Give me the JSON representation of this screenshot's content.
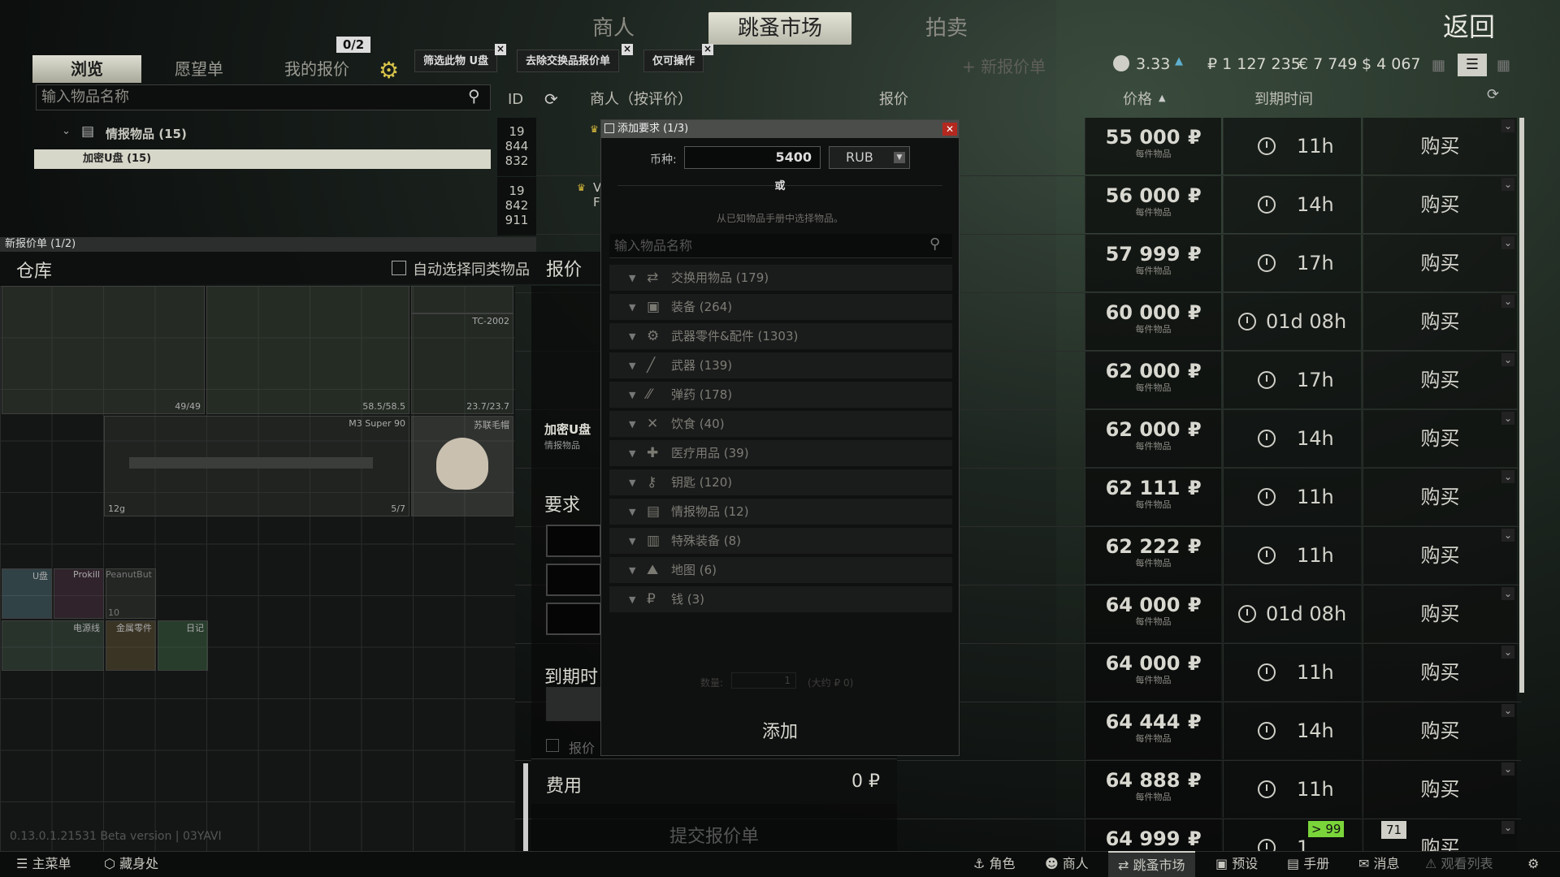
{
  "nav": {
    "tabs": [
      "商人",
      "跳蚤市场",
      "拍卖"
    ],
    "active": "跳蚤市场",
    "back": "返回"
  },
  "subtabs": {
    "browse": "浏览",
    "wishlist": "愿望单",
    "my_offers": "我的报价",
    "offer_count": "0/2"
  },
  "filters": {
    "chips": [
      "筛选此物 U盘",
      "去除交换品报价单",
      "仅可操作"
    ],
    "new_offer": "+ 新报价单"
  },
  "currency": {
    "rep": "3.33",
    "rub": "₽ 1 127 235",
    "eur": "€ 7 749",
    "usd": "$ 4 067"
  },
  "search": {
    "placeholder": "输入物品名称"
  },
  "tree": {
    "category": "情报物品 (15)",
    "item": "加密U盘 (15)"
  },
  "columns": {
    "id": "ID",
    "trader": "商人（按评价）",
    "offer": "报价",
    "price": "价格",
    "expiry": "到期时间"
  },
  "offers_top": [
    {
      "id": "19\n844\n832"
    },
    {
      "id": "19\n842\n911",
      "trader_letter": "V\nF"
    }
  ],
  "rows": [
    {
      "price": "55 000",
      "time": "11h"
    },
    {
      "price": "56 000",
      "time": "14h"
    },
    {
      "price": "57 999",
      "time": "17h"
    },
    {
      "price": "60 000",
      "time": "01d 08h"
    },
    {
      "price": "62 000",
      "time": "17h"
    },
    {
      "price": "62 000",
      "time": "14h"
    },
    {
      "price": "62 111",
      "time": "11h"
    },
    {
      "price": "62 222",
      "time": "11h"
    },
    {
      "price": "64 000",
      "time": "01d 08h"
    },
    {
      "price": "64 000",
      "time": "11h"
    },
    {
      "price": "64 444",
      "time": "14h"
    },
    {
      "price": "64 888",
      "time": "11h"
    },
    {
      "price": "64 999",
      "time": "1"
    }
  ],
  "row_labels": {
    "per_item": "每件物品",
    "buy": "购买",
    "currency_symbol": "₽"
  },
  "last_row": {
    "badge": "> 99",
    "seller_badge": "71"
  },
  "new_offer_panel": {
    "title": "新报价单 (1/2)",
    "stash": "仓库",
    "auto_select": "自动选择同类物品",
    "offer_label": "报价",
    "item_name": "加密U盘",
    "item_cat": "情报物品",
    "requirements": "要求",
    "expiry": "到期时",
    "cost_label": "费用",
    "cost_value": "0 ₽",
    "submit": "提交报价单",
    "offer_checkbox": "报价"
  },
  "stash_items": {
    "armor_count": "49/49",
    "rig_dur": "58.5/58.5",
    "helmet_dur": "23.7/23.7",
    "helmet_tag": "TC-2002",
    "shotgun": "M3 Super 90",
    "shotgun_weight": "12g",
    "shotgun_count": "5/7",
    "hat": "苏联毛帽",
    "usb": "U盘",
    "prokill": "Prokill",
    "peanut": "PeanutBut",
    "peanut_cnt": "10",
    "cable": "电源线",
    "parts": "金属零件",
    "diary": "日记"
  },
  "dialog": {
    "title": "添加要求 (1/3)",
    "currency_label": "币种:",
    "amount": "5400",
    "currency": "RUB",
    "or": "或",
    "hint": "从已知物品手册中选择物品。",
    "search_placeholder": "输入物品名称",
    "qty": "数量:",
    "qty_val": "1",
    "approx": "(大约 ₽ 0)",
    "add": "添加"
  },
  "categories": [
    {
      "icon": "⇄",
      "label": "交换用物品 (179)"
    },
    {
      "icon": "▣",
      "label": "装备 (264)"
    },
    {
      "icon": "⚙",
      "label": "武器零件&配件 (1303)"
    },
    {
      "icon": "╱",
      "label": "武器 (139)"
    },
    {
      "icon": "⁄⁄",
      "label": "弹药 (178)"
    },
    {
      "icon": "✕",
      "label": "饮食 (40)"
    },
    {
      "icon": "✚",
      "label": "医疗用品 (39)"
    },
    {
      "icon": "⚷",
      "label": "钥匙 (120)"
    },
    {
      "icon": "▤",
      "label": "情报物品 (12)"
    },
    {
      "icon": "▥",
      "label": "特殊装备 (8)"
    },
    {
      "icon": "⛰",
      "label": "地图 (6)"
    },
    {
      "icon": "₽",
      "label": "钱 (3)"
    }
  ],
  "version": "0.13.0.1.21531 Beta version | 03YAVI",
  "bottom": {
    "menu": "主菜单",
    "hideout": "藏身处",
    "character": "角色",
    "traders": "商人",
    "flea": "跳蚤市场",
    "presets": "预设",
    "handbook": "手册",
    "messages": "消息",
    "watchlist": "观看列表"
  }
}
